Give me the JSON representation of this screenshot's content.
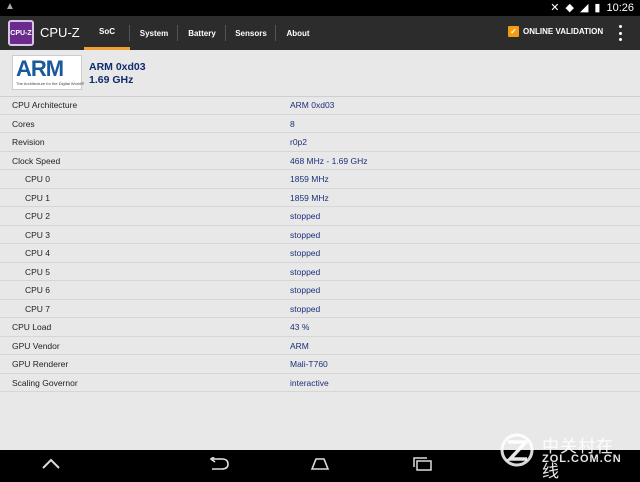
{
  "status_bar": {
    "time": "10:26"
  },
  "app": {
    "title": "CPU-Z",
    "logo_text": "CPU-Z",
    "tabs": [
      "SoC",
      "System",
      "Battery",
      "Sensors",
      "About"
    ],
    "validation_label": "ONLINE VALIDATION"
  },
  "soc": {
    "vendor_logo_text": "ARM",
    "vendor_tagline": "The Architecture for the Digital World®",
    "name": "ARM 0xd03",
    "freq": "1.69 GHz",
    "rows": [
      {
        "label": "CPU Architecture",
        "value": "ARM 0xd03"
      },
      {
        "label": "Cores",
        "value": "8"
      },
      {
        "label": "Revision",
        "value": "r0p2"
      },
      {
        "label": "Clock Speed",
        "value": "468 MHz - 1.69 GHz"
      },
      {
        "label": "CPU 0",
        "value": "1859 MHz"
      },
      {
        "label": "CPU 1",
        "value": "1859 MHz"
      },
      {
        "label": "CPU 2",
        "value": "stopped"
      },
      {
        "label": "CPU 3",
        "value": "stopped"
      },
      {
        "label": "CPU 4",
        "value": "stopped"
      },
      {
        "label": "CPU 5",
        "value": "stopped"
      },
      {
        "label": "CPU 6",
        "value": "stopped"
      },
      {
        "label": "CPU 7",
        "value": "stopped"
      },
      {
        "label": "CPU Load",
        "value": "43 %"
      },
      {
        "label": "GPU Vendor",
        "value": "ARM"
      },
      {
        "label": "GPU Renderer",
        "value": "Mali-T760"
      },
      {
        "label": "Scaling Governor",
        "value": "interactive"
      }
    ]
  },
  "watermark": {
    "cn": "中关村在线",
    "en": "ZOL.COM.CN"
  },
  "colors": {
    "accent": "#f0a030",
    "value_text": "#1c2f7a",
    "action_bar": "#2c2c2c",
    "background": "#e8e8e8"
  }
}
